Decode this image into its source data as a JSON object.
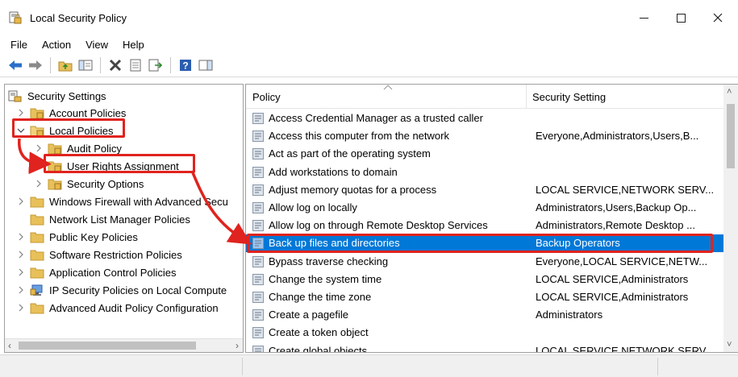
{
  "window": {
    "title": "Local Security Policy",
    "minimize_glyph": "—",
    "maximize_glyph": "☐",
    "close_glyph": "✕"
  },
  "menu": [
    "File",
    "Action",
    "View",
    "Help"
  ],
  "toolbar": {
    "icons": [
      "back-icon",
      "forward-icon",
      "up-folder-icon",
      "show-hide-tree-icon",
      "delete-icon",
      "properties-icon",
      "export-icon",
      "help-icon",
      "action-pane-icon"
    ]
  },
  "tree": {
    "root": "Security Settings",
    "items": [
      {
        "label": "Account Policies",
        "expanded": false
      },
      {
        "label": "Local Policies",
        "expanded": true
      },
      {
        "label": "Audit Policy",
        "expanded": false
      },
      {
        "label": "User Rights Assignment",
        "expanded": false,
        "selected": true
      },
      {
        "label": "Security Options",
        "expanded": false
      },
      {
        "label": "Windows Firewall with Advanced Secu",
        "expanded": false
      },
      {
        "label": "Network List Manager Policies",
        "expanded": false
      },
      {
        "label": "Public Key Policies",
        "expanded": false
      },
      {
        "label": "Software Restriction Policies",
        "expanded": false
      },
      {
        "label": "Application Control Policies",
        "expanded": false
      },
      {
        "label": "IP Security Policies on Local Compute",
        "expanded": false
      },
      {
        "label": "Advanced Audit Policy Configuration",
        "expanded": false
      }
    ]
  },
  "list": {
    "columns": [
      "Policy",
      "Security Setting"
    ],
    "rows": [
      {
        "policy": "Access Credential Manager as a trusted caller",
        "setting": ""
      },
      {
        "policy": "Access this computer from the network",
        "setting": "Everyone,Administrators,Users,B..."
      },
      {
        "policy": "Act as part of the operating system",
        "setting": ""
      },
      {
        "policy": "Add workstations to domain",
        "setting": ""
      },
      {
        "policy": "Adjust memory quotas for a process",
        "setting": "LOCAL SERVICE,NETWORK SERV..."
      },
      {
        "policy": "Allow log on locally",
        "setting": "Administrators,Users,Backup Op..."
      },
      {
        "policy": "Allow log on through Remote Desktop Services",
        "setting": "Administrators,Remote Desktop ..."
      },
      {
        "policy": "Back up files and directories",
        "setting": "Backup Operators",
        "selected": true
      },
      {
        "policy": "Bypass traverse checking",
        "setting": "Everyone,LOCAL SERVICE,NETW..."
      },
      {
        "policy": "Change the system time",
        "setting": "LOCAL SERVICE,Administrators"
      },
      {
        "policy": "Change the time zone",
        "setting": "LOCAL SERVICE,Administrators"
      },
      {
        "policy": "Create a pagefile",
        "setting": "Administrators"
      },
      {
        "policy": "Create a token object",
        "setting": ""
      },
      {
        "policy": "Create global objects",
        "setting": "LOCAL SERVICE,NETWORK SERV..."
      }
    ]
  },
  "colors": {
    "selection": "#0078d7",
    "annotation": "#e0231e",
    "folder": "#e8c05a"
  }
}
